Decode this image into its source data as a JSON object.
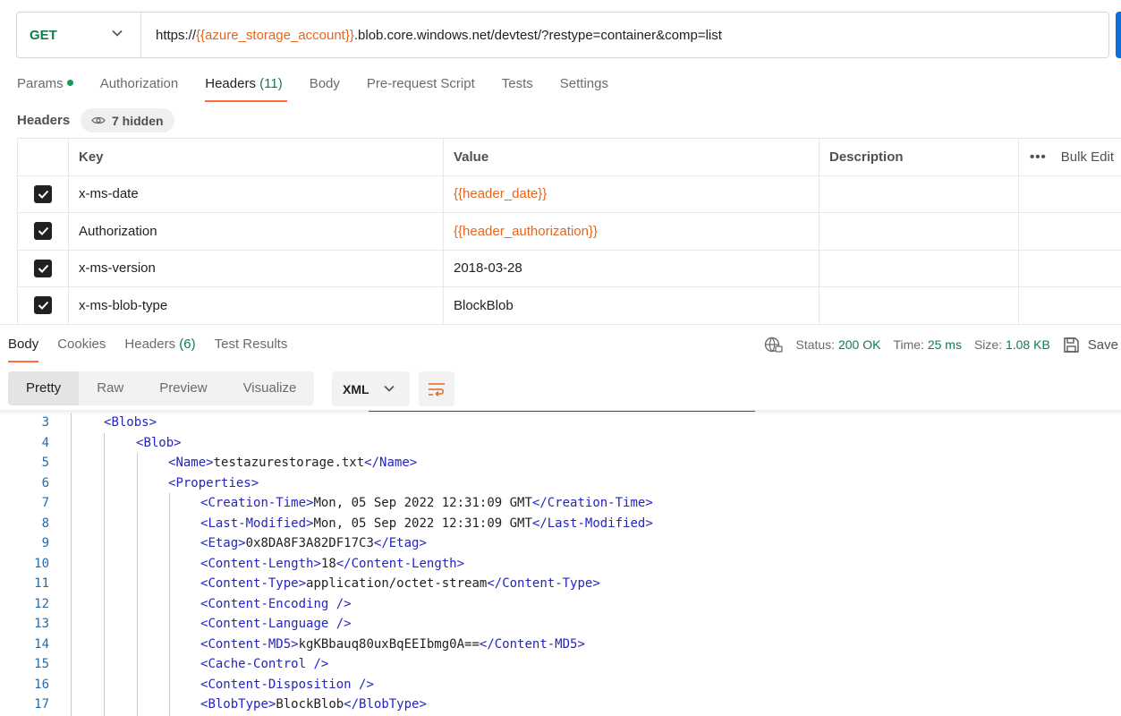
{
  "request": {
    "method": "GET",
    "url_prefix": "https://",
    "url_variable": "{{azure_storage_account}}",
    "url_suffix": ".blob.core.windows.net/devtest/?restype=container&comp=list"
  },
  "request_tabs": [
    {
      "label": "Params",
      "count": ""
    },
    {
      "label": "Authorization",
      "count": ""
    },
    {
      "label": "Headers",
      "count": "(11)"
    },
    {
      "label": "Body",
      "count": ""
    },
    {
      "label": "Pre-request Script",
      "count": ""
    },
    {
      "label": "Tests",
      "count": ""
    },
    {
      "label": "Settings",
      "count": ""
    }
  ],
  "headers_section": {
    "label": "Headers",
    "hidden_label": "7 hidden"
  },
  "headers_table": {
    "columns": [
      "Key",
      "Value",
      "Description"
    ],
    "bulk_edit": "Bulk Edit",
    "more": "•••",
    "rows": [
      {
        "key": "x-ms-date",
        "value": "{{header_date}}",
        "description": ""
      },
      {
        "key": "Authorization",
        "value": "{{header_authorization}}",
        "description": ""
      },
      {
        "key": "x-ms-version",
        "value": "2018-03-28",
        "description": ""
      },
      {
        "key": "x-ms-blob-type",
        "value": "BlockBlob",
        "description": ""
      }
    ]
  },
  "response_tabs": [
    {
      "label": "Body",
      "count": ""
    },
    {
      "label": "Cookies",
      "count": ""
    },
    {
      "label": "Headers",
      "count": "(6)"
    },
    {
      "label": "Test Results",
      "count": ""
    }
  ],
  "response_status": {
    "status_label": "Status:",
    "status_value": "200 OK",
    "time_label": "Time:",
    "time_value": "25 ms",
    "size_label": "Size:",
    "size_value": "1.08 KB",
    "save_label": "Save"
  },
  "body_view": {
    "modes": [
      "Pretty",
      "Raw",
      "Preview",
      "Visualize"
    ],
    "format": "XML"
  },
  "code_lines": [
    {
      "num": "3",
      "open": "Blobs",
      "text": "",
      "close": ""
    },
    {
      "num": "4",
      "open": "Blob",
      "text": "",
      "close": ""
    },
    {
      "num": "5",
      "open": "Name",
      "text": "testazurestorage.txt",
      "close": "Name"
    },
    {
      "num": "6",
      "open": "Properties",
      "text": "",
      "close": ""
    },
    {
      "num": "7",
      "open": "Creation-Time",
      "text": "Mon, 05 Sep 2022 12:31:09 GMT",
      "close": "Creation-Time"
    },
    {
      "num": "8",
      "open": "Last-Modified",
      "text": "Mon, 05 Sep 2022 12:31:09 GMT",
      "close": "Last-Modified"
    },
    {
      "num": "9",
      "open": "Etag",
      "text": "0x8DA8F3A82DF17C3",
      "close": "Etag"
    },
    {
      "num": "10",
      "open": "Content-Length",
      "text": "18",
      "close": "Content-Length"
    },
    {
      "num": "11",
      "open": "Content-Type",
      "text": "application/octet-stream",
      "close": "Content-Type"
    },
    {
      "num": "12",
      "selfclose": "Content-Encoding"
    },
    {
      "num": "13",
      "selfclose": "Content-Language"
    },
    {
      "num": "14",
      "open": "Content-MD5",
      "text": "kgKBbauq80uxBqEEIbmg0A==",
      "close": "Content-MD5"
    },
    {
      "num": "15",
      "selfclose": "Cache-Control"
    },
    {
      "num": "16",
      "selfclose": "Content-Disposition"
    },
    {
      "num": "17",
      "open": "BlobType",
      "text": "BlockBlob",
      "close": "BlobType"
    }
  ]
}
